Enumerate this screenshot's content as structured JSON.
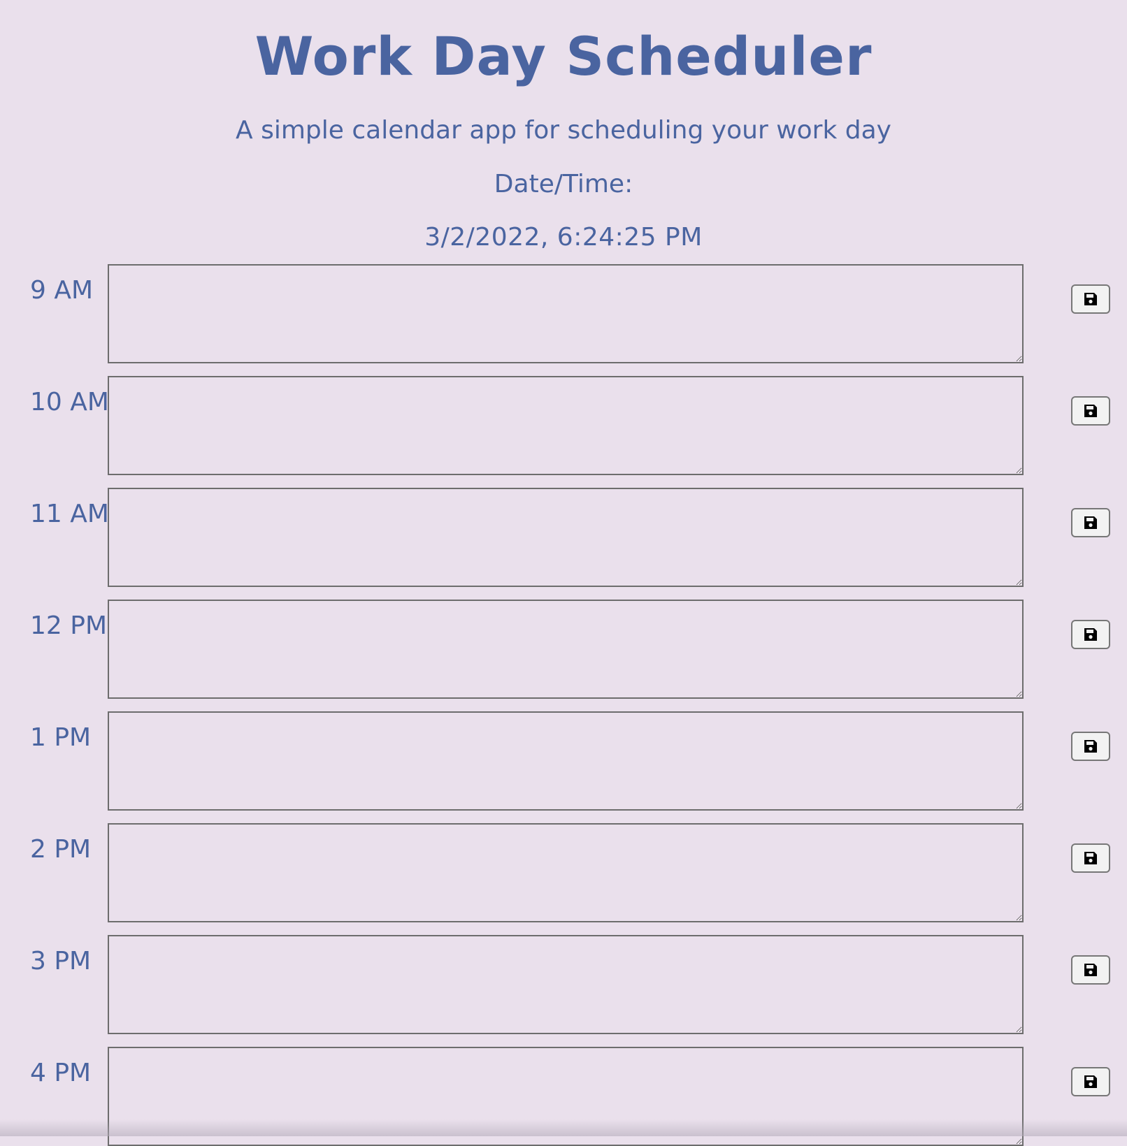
{
  "header": {
    "title": "Work Day Scheduler",
    "subtitle": "A simple calendar app for scheduling your work day",
    "datetime_label": "Date/Time:",
    "datetime_value": "3/2/2022, 6:24:25 PM"
  },
  "hours": [
    {
      "label": "9 AM",
      "value": ""
    },
    {
      "label": "10 AM",
      "value": ""
    },
    {
      "label": "11 AM",
      "value": ""
    },
    {
      "label": "12 PM",
      "value": ""
    },
    {
      "label": "1 PM",
      "value": ""
    },
    {
      "label": "2 PM",
      "value": ""
    },
    {
      "label": "3 PM",
      "value": ""
    },
    {
      "label": "4 PM",
      "value": ""
    }
  ],
  "icons": {
    "save": "save-icon"
  },
  "colors": {
    "background": "#eae0ec",
    "text": "#4a64a0"
  }
}
